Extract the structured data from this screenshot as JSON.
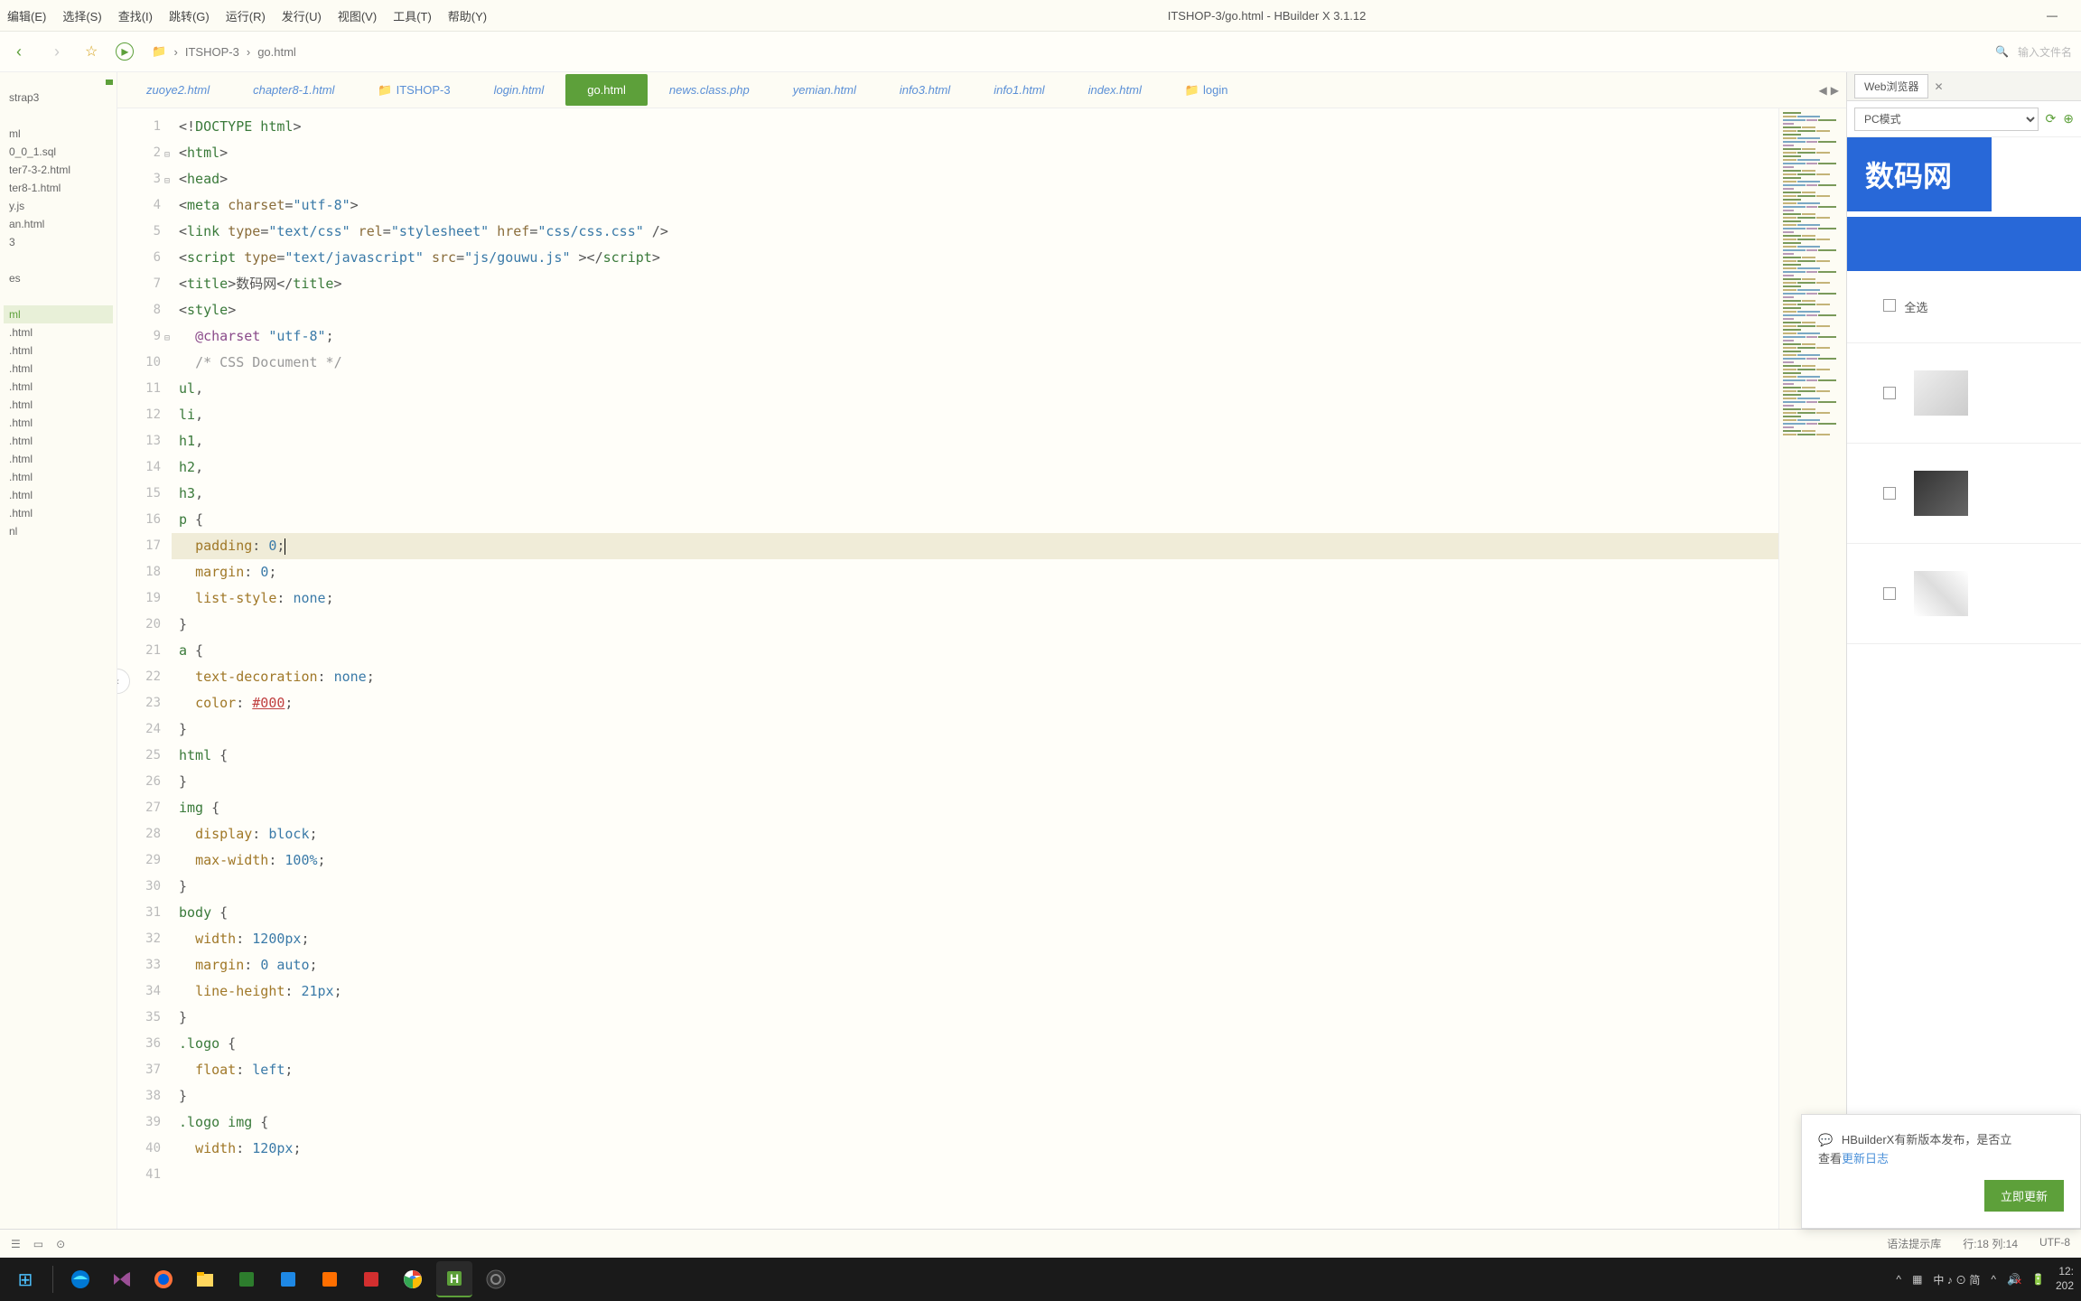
{
  "window": {
    "title": "ITSHOP-3/go.html - HBuilder X 3.1.12"
  },
  "menubar": {
    "items": [
      "编辑(E)",
      "选择(S)",
      "查找(I)",
      "跳转(G)",
      "运行(R)",
      "发行(U)",
      "视图(V)",
      "工具(T)",
      "帮助(Y)"
    ]
  },
  "breadcrumb": {
    "items": [
      "ITSHOP-3",
      "go.html"
    ]
  },
  "toolbar": {
    "search_placeholder": "输入文件名"
  },
  "sidebar": {
    "items": [
      "strap3",
      "ml",
      "0_0_1.sql",
      "ter7-3-2.html",
      "ter8-1.html",
      "y.js",
      "an.html",
      "3",
      "es",
      "ml",
      ".html",
      ".html",
      ".html",
      ".html",
      ".html",
      ".html",
      ".html",
      ".html",
      ".html",
      ".html",
      ".html",
      "nl"
    ],
    "active_index": 9
  },
  "tabs": {
    "items": [
      {
        "label": "zuoye2.html",
        "style": "italic"
      },
      {
        "label": "chapter8-1.html",
        "style": "italic"
      },
      {
        "label": "ITSHOP-3",
        "style": "folder"
      },
      {
        "label": "login.html",
        "style": "italic"
      },
      {
        "label": "go.html",
        "style": "active"
      },
      {
        "label": "news.class.php",
        "style": "italic"
      },
      {
        "label": "yemian.html",
        "style": "italic"
      },
      {
        "label": "info3.html",
        "style": "italic"
      },
      {
        "label": "info1.html",
        "style": "italic"
      },
      {
        "label": "index.html",
        "style": "italic"
      },
      {
        "label": "login",
        "style": "folder"
      }
    ]
  },
  "code": {
    "lines": [
      {
        "n": 1,
        "tokens": [
          {
            "t": "punct",
            "v": "<!"
          },
          {
            "t": "tag",
            "v": "DOCTYPE html"
          },
          {
            "t": "punct",
            "v": ">"
          }
        ]
      },
      {
        "n": 2,
        "fold": true,
        "tokens": [
          {
            "t": "punct",
            "v": "<"
          },
          {
            "t": "tag",
            "v": "html"
          },
          {
            "t": "punct",
            "v": ">"
          }
        ]
      },
      {
        "n": 3,
        "fold": true,
        "tokens": [
          {
            "t": "punct",
            "v": "<"
          },
          {
            "t": "tag",
            "v": "head"
          },
          {
            "t": "punct",
            "v": ">"
          }
        ]
      },
      {
        "n": 4,
        "tokens": [
          {
            "t": "punct",
            "v": "<"
          },
          {
            "t": "tag",
            "v": "meta "
          },
          {
            "t": "attr",
            "v": "charset"
          },
          {
            "t": "punct",
            "v": "="
          },
          {
            "t": "str",
            "v": "\"utf-8\""
          },
          {
            "t": "punct",
            "v": ">"
          }
        ]
      },
      {
        "n": 5,
        "tokens": [
          {
            "t": "punct",
            "v": "<"
          },
          {
            "t": "tag",
            "v": "link "
          },
          {
            "t": "attr",
            "v": "type"
          },
          {
            "t": "punct",
            "v": "="
          },
          {
            "t": "str",
            "v": "\"text/css\""
          },
          {
            "t": "attr",
            "v": " rel"
          },
          {
            "t": "punct",
            "v": "="
          },
          {
            "t": "str",
            "v": "\"stylesheet\""
          },
          {
            "t": "attr",
            "v": " href"
          },
          {
            "t": "punct",
            "v": "="
          },
          {
            "t": "str",
            "v": "\"css/css.css\""
          },
          {
            "t": "punct",
            "v": " />"
          }
        ]
      },
      {
        "n": 6,
        "tokens": []
      },
      {
        "n": 7,
        "tokens": [
          {
            "t": "punct",
            "v": "<"
          },
          {
            "t": "tag",
            "v": "script "
          },
          {
            "t": "attr",
            "v": "type"
          },
          {
            "t": "punct",
            "v": "="
          },
          {
            "t": "str",
            "v": "\"text/javascript\""
          },
          {
            "t": "attr",
            "v": " src"
          },
          {
            "t": "punct",
            "v": "="
          },
          {
            "t": "str",
            "v": "\"js/gouwu.js\""
          },
          {
            "t": "punct",
            "v": " ></"
          },
          {
            "t": "tag",
            "v": "script"
          },
          {
            "t": "punct",
            "v": ">"
          }
        ]
      },
      {
        "n": 8,
        "tokens": [
          {
            "t": "punct",
            "v": "<"
          },
          {
            "t": "tag",
            "v": "title"
          },
          {
            "t": "punct",
            "v": ">"
          },
          {
            "t": "txt",
            "v": "数码网"
          },
          {
            "t": "punct",
            "v": "</"
          },
          {
            "t": "tag",
            "v": "title"
          },
          {
            "t": "punct",
            "v": ">"
          }
        ]
      },
      {
        "n": 9,
        "fold": true,
        "tokens": [
          {
            "t": "punct",
            "v": "<"
          },
          {
            "t": "tag",
            "v": "style"
          },
          {
            "t": "punct",
            "v": ">"
          }
        ]
      },
      {
        "n": 10,
        "tokens": [
          {
            "t": "txt",
            "v": "  "
          },
          {
            "t": "kw",
            "v": "@charset"
          },
          {
            "t": "txt",
            "v": " "
          },
          {
            "t": "str",
            "v": "\"utf-8\""
          },
          {
            "t": "punct",
            "v": ";"
          }
        ]
      },
      {
        "n": 11,
        "tokens": [
          {
            "t": "txt",
            "v": "  "
          },
          {
            "t": "comment",
            "v": "/* CSS Document */"
          }
        ]
      },
      {
        "n": 12,
        "tokens": [
          {
            "t": "tag",
            "v": "ul"
          },
          {
            "t": "punct",
            "v": ","
          }
        ]
      },
      {
        "n": 13,
        "tokens": [
          {
            "t": "tag",
            "v": "li"
          },
          {
            "t": "punct",
            "v": ","
          }
        ]
      },
      {
        "n": 14,
        "tokens": [
          {
            "t": "tag",
            "v": "h1"
          },
          {
            "t": "punct",
            "v": ","
          }
        ]
      },
      {
        "n": 15,
        "tokens": [
          {
            "t": "tag",
            "v": "h2"
          },
          {
            "t": "punct",
            "v": ","
          }
        ]
      },
      {
        "n": 16,
        "tokens": [
          {
            "t": "tag",
            "v": "h3"
          },
          {
            "t": "punct",
            "v": ","
          }
        ]
      },
      {
        "n": 17,
        "tokens": [
          {
            "t": "tag",
            "v": "p"
          },
          {
            "t": "punct",
            "v": " {"
          }
        ]
      },
      {
        "n": 18,
        "hl": true,
        "tokens": [
          {
            "t": "txt",
            "v": "  "
          },
          {
            "t": "prop",
            "v": "padding"
          },
          {
            "t": "punct",
            "v": ": "
          },
          {
            "t": "num",
            "v": "0"
          },
          {
            "t": "punct",
            "v": ";"
          }
        ],
        "cursor": true
      },
      {
        "n": 19,
        "tokens": [
          {
            "t": "txt",
            "v": "  "
          },
          {
            "t": "prop",
            "v": "margin"
          },
          {
            "t": "punct",
            "v": ": "
          },
          {
            "t": "num",
            "v": "0"
          },
          {
            "t": "punct",
            "v": ";"
          }
        ]
      },
      {
        "n": 20,
        "tokens": [
          {
            "t": "txt",
            "v": "  "
          },
          {
            "t": "prop",
            "v": "list-style"
          },
          {
            "t": "punct",
            "v": ": "
          },
          {
            "t": "val",
            "v": "none"
          },
          {
            "t": "punct",
            "v": ";"
          }
        ]
      },
      {
        "n": 21,
        "tokens": [
          {
            "t": "punct",
            "v": "}"
          }
        ]
      },
      {
        "n": 22,
        "tokens": [
          {
            "t": "tag",
            "v": "a"
          },
          {
            "t": "punct",
            "v": " {"
          }
        ]
      },
      {
        "n": 23,
        "tokens": [
          {
            "t": "txt",
            "v": "  "
          },
          {
            "t": "prop",
            "v": "text-decoration"
          },
          {
            "t": "punct",
            "v": ": "
          },
          {
            "t": "val",
            "v": "none"
          },
          {
            "t": "punct",
            "v": ";"
          }
        ]
      },
      {
        "n": 24,
        "tokens": [
          {
            "t": "txt",
            "v": "  "
          },
          {
            "t": "prop",
            "v": "color"
          },
          {
            "t": "punct",
            "v": ": "
          },
          {
            "t": "color-hex",
            "v": "#000"
          },
          {
            "t": "punct",
            "v": ";"
          }
        ]
      },
      {
        "n": 25,
        "tokens": [
          {
            "t": "punct",
            "v": "}"
          }
        ]
      },
      {
        "n": 26,
        "tokens": [
          {
            "t": "tag",
            "v": "html"
          },
          {
            "t": "punct",
            "v": " {"
          }
        ]
      },
      {
        "n": 27,
        "tokens": [
          {
            "t": "punct",
            "v": "}"
          }
        ]
      },
      {
        "n": 28,
        "tokens": [
          {
            "t": "tag",
            "v": "img"
          },
          {
            "t": "punct",
            "v": " {"
          }
        ]
      },
      {
        "n": 29,
        "tokens": [
          {
            "t": "txt",
            "v": "  "
          },
          {
            "t": "prop",
            "v": "display"
          },
          {
            "t": "punct",
            "v": ": "
          },
          {
            "t": "val",
            "v": "block"
          },
          {
            "t": "punct",
            "v": ";"
          }
        ]
      },
      {
        "n": 30,
        "tokens": [
          {
            "t": "txt",
            "v": "  "
          },
          {
            "t": "prop",
            "v": "max-width"
          },
          {
            "t": "punct",
            "v": ": "
          },
          {
            "t": "num",
            "v": "100%"
          },
          {
            "t": "punct",
            "v": ";"
          }
        ]
      },
      {
        "n": 31,
        "tokens": [
          {
            "t": "punct",
            "v": "}"
          }
        ]
      },
      {
        "n": 32,
        "tokens": [
          {
            "t": "tag",
            "v": "body"
          },
          {
            "t": "punct",
            "v": " {"
          }
        ]
      },
      {
        "n": 33,
        "tokens": [
          {
            "t": "txt",
            "v": "  "
          },
          {
            "t": "prop",
            "v": "width"
          },
          {
            "t": "punct",
            "v": ": "
          },
          {
            "t": "num",
            "v": "1200px"
          },
          {
            "t": "punct",
            "v": ";"
          }
        ]
      },
      {
        "n": 34,
        "tokens": [
          {
            "t": "txt",
            "v": "  "
          },
          {
            "t": "prop",
            "v": "margin"
          },
          {
            "t": "punct",
            "v": ": "
          },
          {
            "t": "num",
            "v": "0"
          },
          {
            "t": "val",
            "v": " auto"
          },
          {
            "t": "punct",
            "v": ";"
          }
        ]
      },
      {
        "n": 35,
        "tokens": [
          {
            "t": "txt",
            "v": "  "
          },
          {
            "t": "prop",
            "v": "line-height"
          },
          {
            "t": "punct",
            "v": ": "
          },
          {
            "t": "num",
            "v": "21px"
          },
          {
            "t": "punct",
            "v": ";"
          }
        ]
      },
      {
        "n": 36,
        "tokens": [
          {
            "t": "punct",
            "v": "}"
          }
        ]
      },
      {
        "n": 37,
        "tokens": [
          {
            "t": "tag",
            "v": ".logo"
          },
          {
            "t": "punct",
            "v": " {"
          }
        ]
      },
      {
        "n": 38,
        "tokens": [
          {
            "t": "txt",
            "v": "  "
          },
          {
            "t": "prop",
            "v": "float"
          },
          {
            "t": "punct",
            "v": ": "
          },
          {
            "t": "val",
            "v": "left"
          },
          {
            "t": "punct",
            "v": ";"
          }
        ]
      },
      {
        "n": 39,
        "tokens": [
          {
            "t": "punct",
            "v": "}"
          }
        ]
      },
      {
        "n": 40,
        "tokens": [
          {
            "t": "tag",
            "v": ".logo img"
          },
          {
            "t": "punct",
            "v": " {"
          }
        ]
      },
      {
        "n": 41,
        "tokens": [
          {
            "t": "txt",
            "v": "  "
          },
          {
            "t": "prop",
            "v": "width"
          },
          {
            "t": "punct",
            "v": ": "
          },
          {
            "t": "num",
            "v": "120px"
          },
          {
            "t": "punct",
            "v": ";"
          }
        ]
      }
    ]
  },
  "preview": {
    "tab_label": "Web浏览器",
    "mode": "PC模式",
    "logo_text": "数码网",
    "select_all": "全选"
  },
  "notification": {
    "text_prefix": "HBuilderX有新版本发布，是否立",
    "text_line2": "查看",
    "link": "更新日志",
    "button": "立即更新"
  },
  "statusbar": {
    "syntax": "语法提示库",
    "position": "行:18  列:14",
    "encoding": "UTF-8"
  },
  "taskbar": {
    "time": "12:",
    "date": "202",
    "ime": "中 ♪ ⊙ 简"
  }
}
